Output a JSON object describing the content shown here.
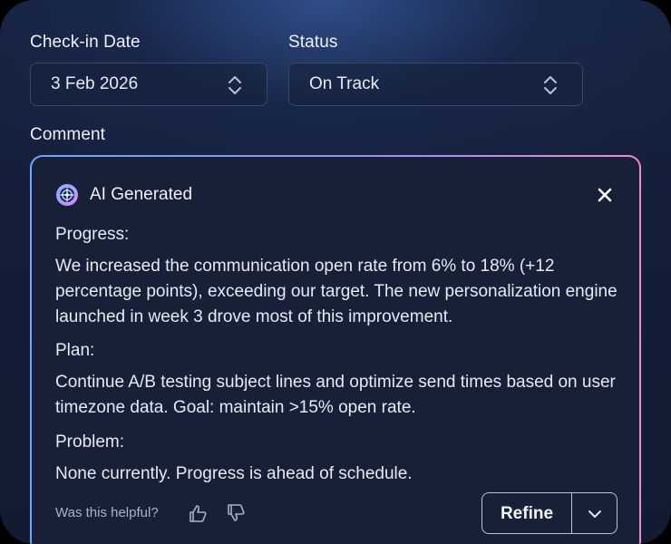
{
  "form": {
    "checkin_label": "Check-in Date",
    "checkin_value": "3 Feb 2026",
    "status_label": "Status",
    "status_value": "On Track",
    "comment_label": "Comment"
  },
  "ai_comment": {
    "title": "AI Generated",
    "progress_heading": "Progress:",
    "progress_text": "We increased the communication open rate from 6% to 18% (+12 percentage points),  exceeding our target. The new personalization engine launched in week 3 drove  most of this improvement.",
    "plan_heading": "Plan:",
    "plan_text": "Continue A/B testing subject lines and optimize send times based on user  timezone data. Goal: maintain >15% open rate.",
    "problem_heading": "Problem:",
    "problem_text": "None currently. Progress is ahead of schedule.",
    "helpful_prompt": "Was this helpful?",
    "refine_label": "Refine"
  },
  "colors": {
    "border_gradient_start": "#6fa6ff",
    "border_gradient_end": "#f08ad0",
    "card_background": "#141d36"
  }
}
